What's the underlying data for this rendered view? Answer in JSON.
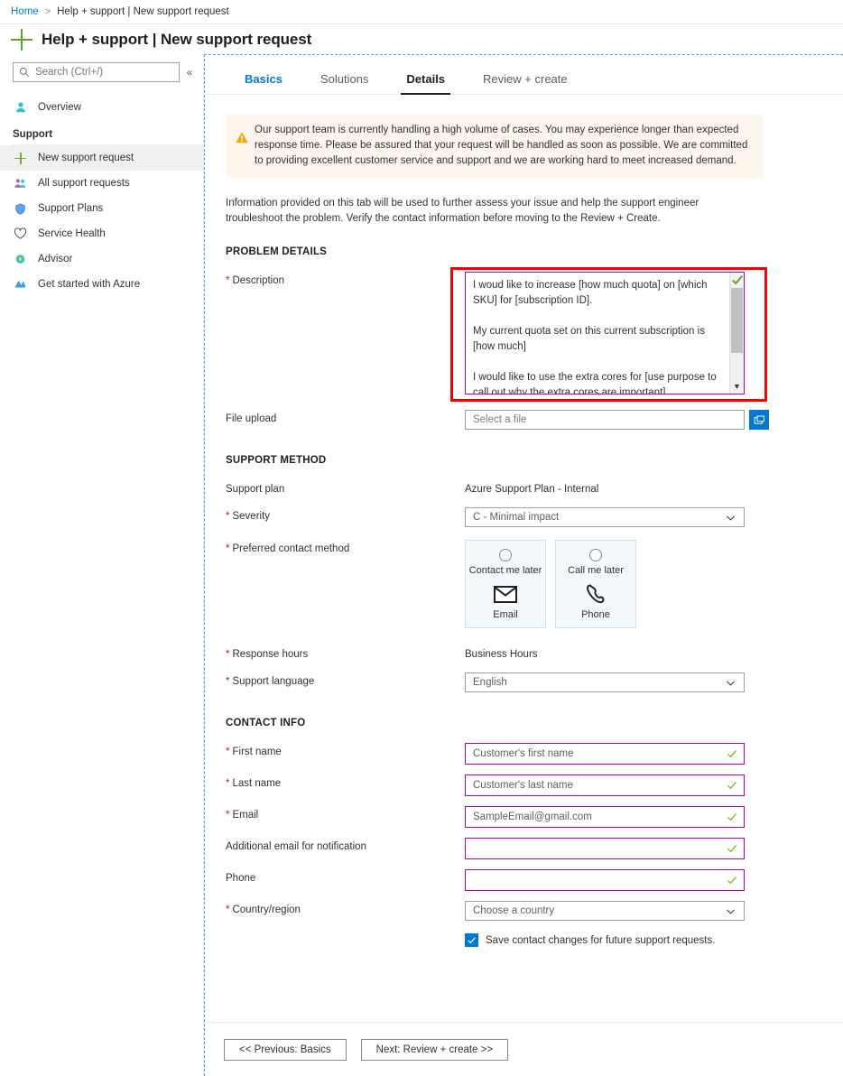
{
  "breadcrumb": {
    "home": "Home",
    "separator": ">",
    "current": "Help + support | New support request"
  },
  "header": {
    "title": "Help + support | New support request"
  },
  "sidebar": {
    "search_placeholder": "Search (Ctrl+/)",
    "collapse_label": "«",
    "overview": "Overview",
    "section_title": "Support",
    "items": [
      {
        "label": "New support request",
        "icon": "plus-icon"
      },
      {
        "label": "All support requests",
        "icon": "people-icon"
      },
      {
        "label": "Support Plans",
        "icon": "shield-icon"
      },
      {
        "label": "Service Health",
        "icon": "heart-pulse-icon"
      },
      {
        "label": "Advisor",
        "icon": "advisor-icon"
      },
      {
        "label": "Get started with Azure",
        "icon": "rocket-icon"
      }
    ]
  },
  "tabs": [
    {
      "label": "Basics",
      "state": "visited"
    },
    {
      "label": "Solutions",
      "state": "normal"
    },
    {
      "label": "Details",
      "state": "active"
    },
    {
      "label": "Review + create",
      "state": "normal"
    }
  ],
  "banner": {
    "text": "Our support team is currently handling a high volume of cases. You may experience longer than expected response time. Please be assured that your request will be handled as soon as possible. We are committed to providing excellent customer service and support and we are working hard to meet increased demand."
  },
  "intro": "Information provided on this tab will be used to further assess your issue and help the support engineer troubleshoot the problem. Verify the contact information before moving to the Review + Create.",
  "problem_details": {
    "section": "PROBLEM DETAILS",
    "description_label": "Description",
    "description_value_p1": "I woud like to increase [how much quota] on [which SKU] for [subscription ID].",
    "description_value_p2": "My current quota set on this current subscription is [how much]",
    "description_value_p3": "I would like to use the extra cores for [use purpose to call out why the extra cores are important]",
    "file_upload_label": "File upload",
    "file_upload_placeholder": "Select a file"
  },
  "support_method": {
    "section": "SUPPORT METHOD",
    "support_plan_label": "Support plan",
    "support_plan_value": "Azure Support Plan - Internal",
    "severity_label": "Severity",
    "severity_value": "C - Minimal impact",
    "contact_method_label": "Preferred contact method",
    "cards": [
      {
        "top_label": "Contact me later",
        "bottom_label": "Email",
        "icon": "envelope-icon",
        "selected": false
      },
      {
        "top_label": "Call me later",
        "bottom_label": "Phone",
        "icon": "phone-icon",
        "selected": false
      }
    ],
    "response_hours_label": "Response hours",
    "response_hours_value": "Business Hours",
    "language_label": "Support language",
    "language_value": "English"
  },
  "contact_info": {
    "section": "CONTACT INFO",
    "first_name_label": "First name",
    "first_name_value": "Customer's first name",
    "last_name_label": "Last name",
    "last_name_value": "Customer's last name",
    "email_label": "Email",
    "email_value": "SampleEmail@gmail.com",
    "additional_email_label": "Additional email for notification",
    "additional_email_value": "",
    "phone_label": "Phone",
    "phone_value": "",
    "country_label": "Country/region",
    "country_value": "Choose a country",
    "save_checkbox_label": "Save contact changes for future support requests."
  },
  "footer": {
    "previous": "<< Previous: Basics",
    "next": "Next: Review + create >>"
  },
  "colors": {
    "accent_blue": "#0078d4",
    "validation_purple": "#b4009e",
    "annotation_red": "#fa0000",
    "warn_orange": "#f7a704",
    "green_plus": "#70ad47",
    "banner_bg": "#fdf6ec"
  }
}
